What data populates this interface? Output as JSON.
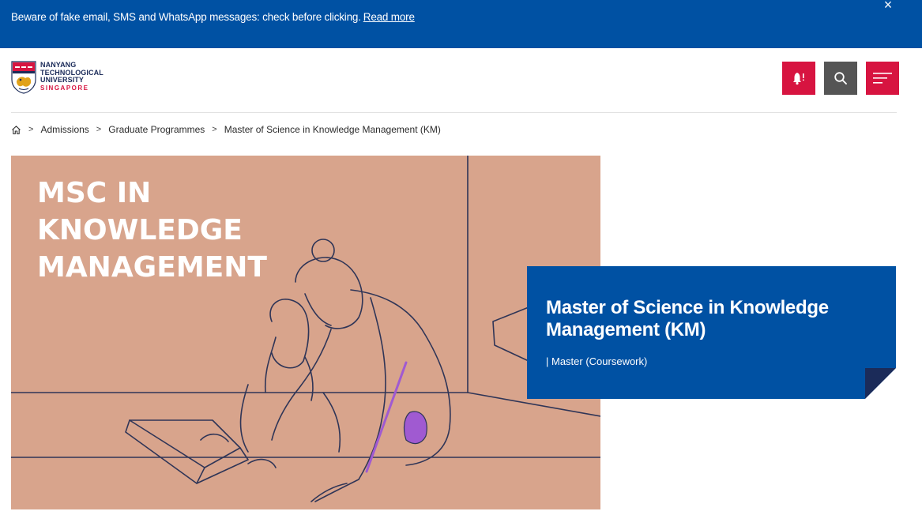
{
  "alert": {
    "message": "Beware of fake email, SMS and WhatsApp messages: check before clicking.",
    "link_label": "Read more",
    "close_symbol": "×"
  },
  "logo": {
    "line1": "NANYANG",
    "line2": "TECHNOLOGICAL",
    "line3": "UNIVERSITY",
    "line4": "SINGAPORE"
  },
  "header": {
    "icons": [
      "bell-icon",
      "search-icon",
      "menu-icon"
    ]
  },
  "breadcrumb": {
    "items": [
      "Admissions",
      "Graduate Programmes",
      "Master of Science in Knowledge Management (KM)"
    ],
    "separator": ">"
  },
  "hero": {
    "image_title_line1": "MSC IN",
    "image_title_line2": "KNOWLEDGE",
    "image_title_line3": "MANAGEMENT"
  },
  "card": {
    "title": "Master of Science in Knowledge Management (KM)",
    "subtitle": "| Master (Coursework)"
  },
  "colors": {
    "brand_blue": "#0051a3",
    "brand_red": "#d71440",
    "search_grey": "#555555",
    "hero_peach": "#d8a48c",
    "fold_navy": "#1b2b59"
  }
}
